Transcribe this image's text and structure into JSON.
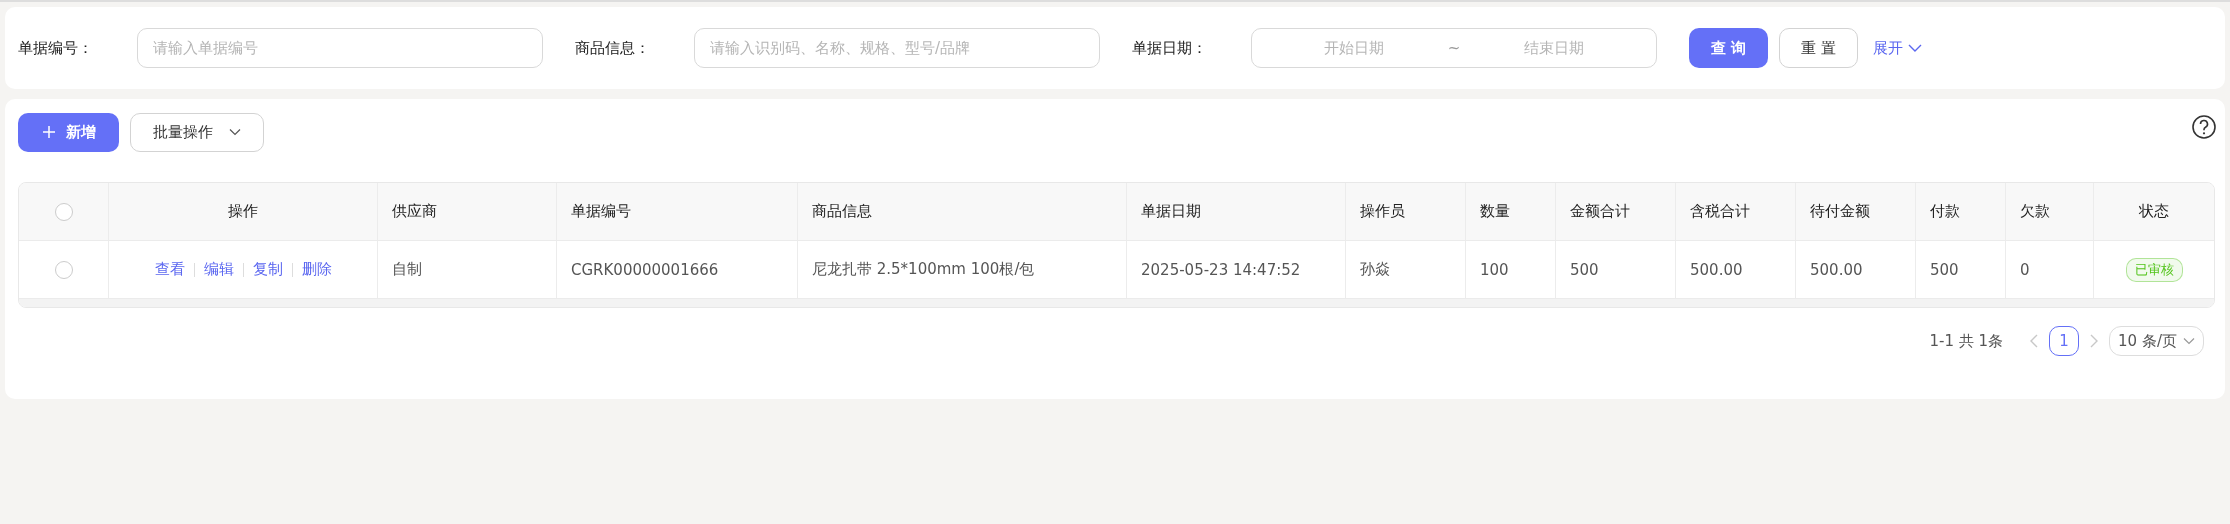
{
  "filters": [
    {
      "label": "单据编号：",
      "kind": "text",
      "placeholder": "请输入单据编号"
    },
    {
      "label": "商品信息：",
      "kind": "text",
      "placeholder": "请输入识别码、名称、规格、型号/品牌"
    },
    {
      "label": "单据日期：",
      "kind": "range",
      "start_placeholder": "开始日期",
      "separator": "~",
      "end_placeholder": "结束日期"
    }
  ],
  "search_button": "查 询",
  "reset_button": "重 置",
  "expand_link": "展开",
  "toolbar": {
    "add_button": "新增",
    "batch_button": "批量操作"
  },
  "table": {
    "select_all_checked": false,
    "columns": [
      "操作",
      "供应商",
      "单据编号",
      "商品信息",
      "单据日期",
      "操作员",
      "数量",
      "金额合计",
      "含税合计",
      "待付金额",
      "付款",
      "欠款",
      "状态"
    ],
    "rows": [
      {
        "selected": false,
        "cells": [
          {
            "kind": "actions",
            "links": [
              "查看",
              "编辑",
              "复制",
              "删除"
            ]
          },
          {
            "kind": "text",
            "text": "自制"
          },
          {
            "kind": "text",
            "text": "CGRK00000001666"
          },
          {
            "kind": "text",
            "text": "尼龙扎带 2.5*100mm 100根/包"
          },
          {
            "kind": "text",
            "text": "2025-05-23 14:47:52"
          },
          {
            "kind": "text",
            "text": "孙焱"
          },
          {
            "kind": "text",
            "text": "100"
          },
          {
            "kind": "text",
            "text": "500"
          },
          {
            "kind": "text",
            "text": "500.00"
          },
          {
            "kind": "text",
            "text": "500.00"
          },
          {
            "kind": "text",
            "text": "500"
          },
          {
            "kind": "text",
            "text": "0"
          },
          {
            "kind": "tag",
            "text": "已审核",
            "color": "#52c41a"
          }
        ]
      }
    ]
  },
  "pagination": {
    "summary": "1-1 共 1条",
    "prev_disabled": true,
    "next_disabled": true,
    "pages": [
      {
        "label": "1",
        "selected": true
      }
    ],
    "page_size": "10 条/页"
  }
}
